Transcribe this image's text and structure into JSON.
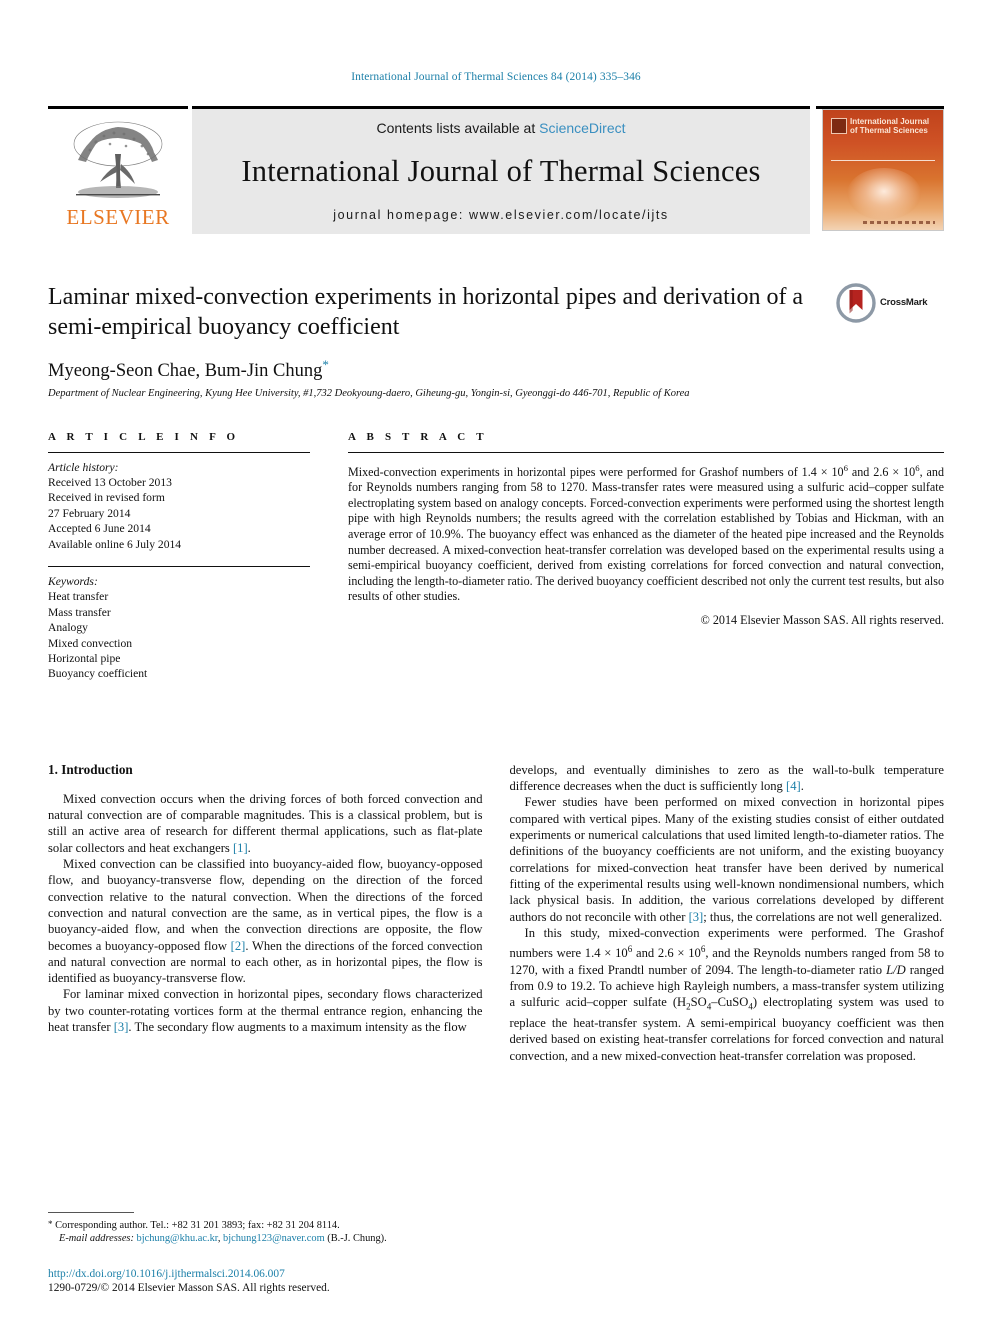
{
  "running_head": "International Journal of Thermal Sciences 84 (2014) 335–346",
  "masthead": {
    "publisher_logo_text": "ELSEVIER",
    "contents_prefix": "Contents lists available at ",
    "contents_link": "ScienceDirect",
    "journal_title": "International Journal of Thermal Sciences",
    "homepage_line": "journal homepage: www.elsevier.com/locate/ijts",
    "cover_title": "International Journal of Thermal Sciences"
  },
  "article": {
    "title": "Laminar mixed-convection experiments in horizontal pipes and derivation of a semi-empirical buoyancy coefficient",
    "crossmark_label": "CrossMark",
    "authors": "Myeong-Seon Chae, Bum-Jin Chung",
    "corresponding_marker": "*",
    "affiliation": "Department of Nuclear Engineering, Kyung Hee University, #1,732 Deokyoung-daero, Giheung-gu, Yongin-si, Gyeonggi-do 446-701, Republic of Korea"
  },
  "article_info": {
    "heading": "A R T I C L E  I N F O",
    "history_label": "Article history:",
    "history": [
      "Received 13 October 2013",
      "Received in revised form",
      "27 February 2014",
      "Accepted 6 June 2014",
      "Available online 6 July 2014"
    ],
    "keywords_label": "Keywords:",
    "keywords": [
      "Heat transfer",
      "Mass transfer",
      "Analogy",
      "Mixed convection",
      "Horizontal pipe",
      "Buoyancy coefficient"
    ]
  },
  "abstract": {
    "heading": "A B S T R A C T",
    "paragraph_1": "Mixed-convection experiments in horizontal pipes were performed for Grashof numbers of 1.4 × 10",
    "paragraph_1b": " and 2.6 × 10",
    "paragraph_1c": ", and for Reynolds numbers ranging from 58 to 1270. Mass-transfer rates were measured using a sulfuric acid–copper sulfate electroplating system based on analogy concepts. Forced-convection experiments were performed using the shortest length pipe with high Reynolds numbers; the results agreed with the correlation established by Tobias and Hickman, with an average error of 10.9%. The buoyancy effect was enhanced as the diameter of the heated pipe increased and the Reynolds number decreased. A mixed-convection heat-transfer correlation was developed based on the experimental results using a semi-empirical buoyancy coefficient, derived from existing correlations for forced convection and natural convection, including the length-to-diameter ratio. The derived buoyancy coefficient described not only the current test results, but also results of other studies.",
    "exponent": "6",
    "copyright": "© 2014 Elsevier Masson SAS. All rights reserved."
  },
  "body": {
    "section_title": "1. Introduction",
    "left_paragraphs": [
      {
        "text_a": "Mixed convection occurs when the driving forces of both forced convection and natural convection are of comparable magnitudes. This is a classical problem, but is still an active area of research for different thermal applications, such as flat-plate solar collectors and heat exchangers ",
        "ref": "[1]",
        "text_b": "."
      },
      {
        "text_a": "Mixed convection can be classified into buoyancy-aided flow, buoyancy-opposed flow, and buoyancy-transverse flow, depending on the direction of the forced convection relative to the natural convection. When the directions of the forced convection and natural convection are the same, as in vertical pipes, the flow is a buoyancy-aided flow, and when the convection directions are opposite, the flow becomes a buoyancy-opposed flow ",
        "ref": "[2]",
        "text_b": ". When the directions of the forced convection and natural convection are normal to each other, as in horizontal pipes, the flow is identified as buoyancy-transverse flow."
      },
      {
        "text_a": "For laminar mixed convection in horizontal pipes, secondary flows characterized by two counter-rotating vortices form at the thermal entrance region, enhancing the heat transfer ",
        "ref": "[3]",
        "text_b": ". The secondary flow augments to a maximum intensity as the flow"
      }
    ],
    "right_paragraphs": [
      {
        "text_a": "develops, and eventually diminishes to zero as the wall-to-bulk temperature difference decreases when the duct is sufficiently long ",
        "ref": "[4]",
        "text_b": "."
      },
      {
        "text_a": "Fewer studies have been performed on mixed convection in horizontal pipes compared with vertical pipes. Many of the existing studies consist of either outdated experiments or numerical calculations that used limited length-to-diameter ratios. The definitions of the buoyancy coefficients are not uniform, and the existing buoyancy correlations for mixed-convection heat transfer have been derived by numerical fitting of the experimental results using well-known nondimensional numbers, which lack physical basis. In addition, the various correlations developed by different authors do not reconcile with other ",
        "ref": "[3]",
        "text_b": "; thus, the correlations are not well generalized."
      }
    ],
    "right_last_paragraph": {
      "p1": "In this study, mixed-convection experiments were performed. The Grashof numbers were 1.4 × 10",
      "p2": " and 2.6 × 10",
      "p3": ", and the Reynolds numbers ranged from 58 to 1270, with a fixed Prandtl number of 2094. The length-to-diameter ratio ",
      "italic_ld": "L/D",
      "p4": " ranged from 0.9 to 19.2. To achieve high Rayleigh numbers, a mass-transfer system utilizing a sulfuric acid–copper sulfate (H",
      "sub1": "2",
      "p5": "SO",
      "sub2": "4",
      "p6": "–CuSO",
      "sub3": "4",
      "p7": ") electroplating system was used to replace the heat-transfer system. A semi-empirical buoyancy coefficient was then derived based on existing heat-transfer correlations for forced convection and natural convection, and a new mixed-convection heat-transfer correlation was proposed.",
      "exponent": "6"
    }
  },
  "footnote": {
    "bullet": "*",
    "line1": " Corresponding author. Tel.: +82 31 201 3893; fax: +82 31 204 8114.",
    "email_label": "E-mail addresses:",
    "email1": "bjchung@khu.ac.kr",
    "email_sep": ", ",
    "email2": "bjchung123@naver.com",
    "email_suffix": " (B.-J. Chung)."
  },
  "footer": {
    "doi": "http://dx.doi.org/10.1016/j.ijthermalsci.2014.06.007",
    "issn": "1290-0729/© 2014 Elsevier Masson SAS. All rights reserved."
  },
  "colors": {
    "link": "#1b7fa8",
    "sciencedirect": "#3a8fc0",
    "elsevier_orange": "#e87722",
    "cover_rust": "#c0431c",
    "crossmark_red": "#b5231f"
  }
}
